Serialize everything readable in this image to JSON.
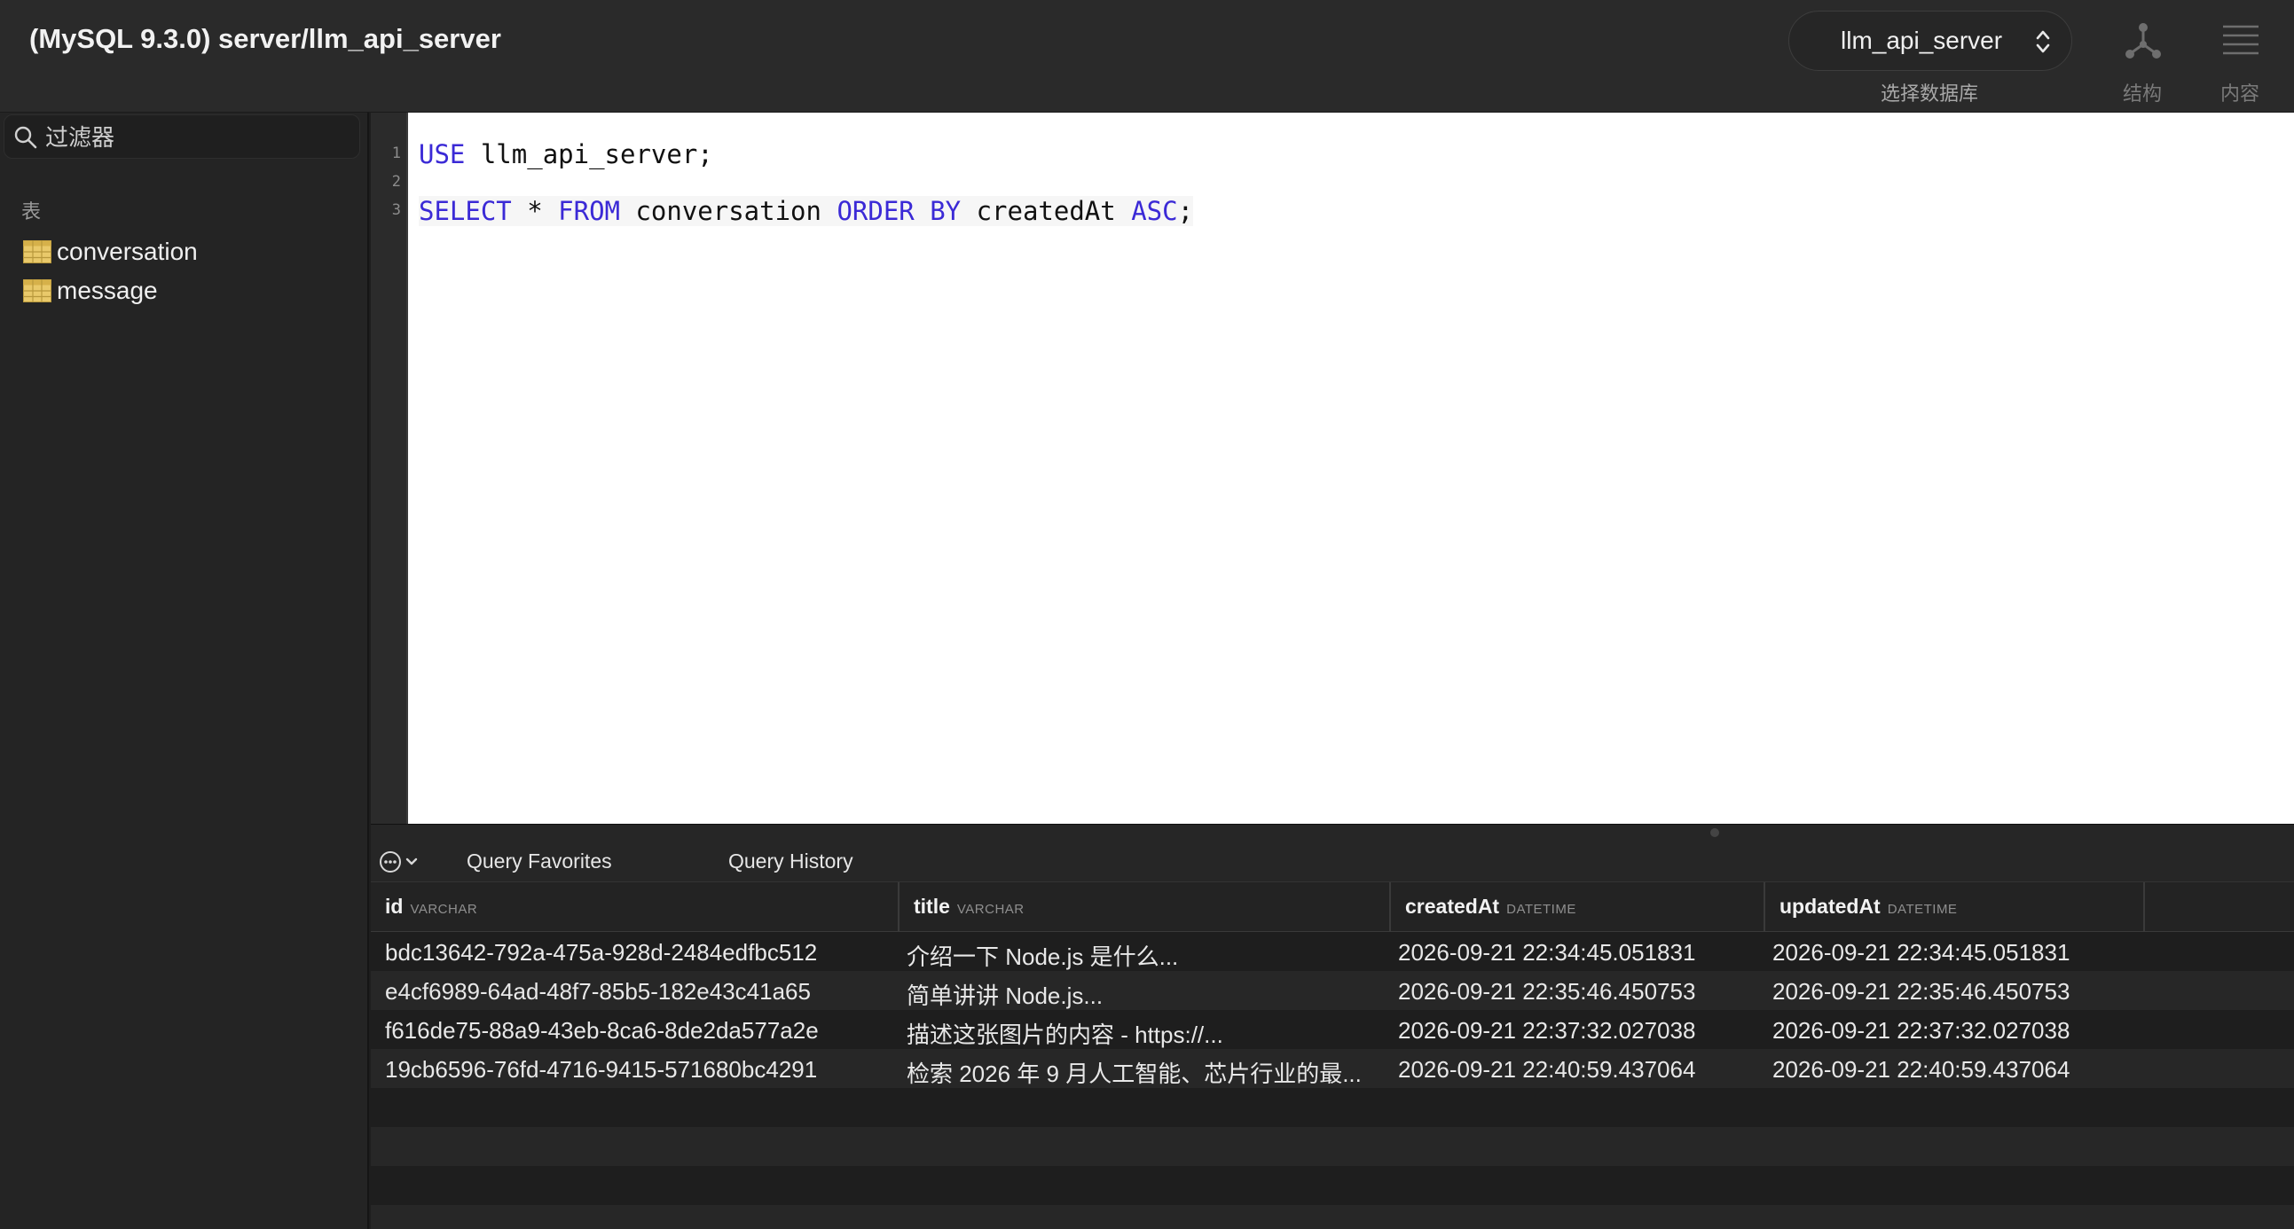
{
  "window": {
    "title": "(MySQL 9.3.0) server/llm_api_server"
  },
  "toolbar": {
    "database_select": {
      "value": "llm_api_server",
      "caption": "选择数据库"
    },
    "buttons": [
      {
        "label": "结构",
        "icon": "structure-icon"
      },
      {
        "label": "内容",
        "icon": "content-icon"
      }
    ]
  },
  "sidebar": {
    "filter": {
      "placeholder": "过滤器",
      "value": ""
    },
    "section_label": "表",
    "tables": [
      {
        "name": "conversation",
        "icon": "table-icon"
      },
      {
        "name": "message",
        "icon": "table-icon"
      }
    ]
  },
  "editor": {
    "line_numbers": [
      "1",
      "2",
      "3"
    ],
    "lines": [
      {
        "tokens": [
          {
            "t": "USE",
            "kw": true
          },
          {
            "t": " llm_api_server;",
            "kw": false
          }
        ]
      },
      {
        "tokens": []
      },
      {
        "tokens": [
          {
            "t": "SELECT",
            "kw": true
          },
          {
            "t": " * ",
            "kw": false
          },
          {
            "t": "FROM",
            "kw": true
          },
          {
            "t": " conversation ",
            "kw": false
          },
          {
            "t": "ORDER BY",
            "kw": true
          },
          {
            "t": " createdAt ",
            "kw": false
          },
          {
            "t": "ASC",
            "kw": true
          },
          {
            "t": ";",
            "kw": false
          }
        ]
      }
    ],
    "colors": {
      "keyword": "#3b2ad6",
      "text": "#111111"
    }
  },
  "results": {
    "tabs": [
      "Query Favorites",
      "Query History"
    ],
    "columns": [
      {
        "name": "id",
        "type": "VARCHAR"
      },
      {
        "name": "title",
        "type": "VARCHAR"
      },
      {
        "name": "createdAt",
        "type": "DATETIME"
      },
      {
        "name": "updatedAt",
        "type": "DATETIME"
      }
    ],
    "rows": [
      [
        "bdc13642-792a-475a-928d-2484edfbc512",
        "介绍一下 Node.js 是什么...",
        "2026-09-21 22:34:45.051831",
        "2026-09-21 22:34:45.051831"
      ],
      [
        "e4cf6989-64ad-48f7-85b5-182e43c41a65",
        "简单讲讲 Node.js...",
        "2026-09-21 22:35:46.450753",
        "2026-09-21 22:35:46.450753"
      ],
      [
        "f616de75-88a9-43eb-8ca6-8de2da577a2e",
        "描述这张图片的内容 - https://...",
        "2026-09-21 22:37:32.027038",
        "2026-09-21 22:37:32.027038"
      ],
      [
        "19cb6596-76fd-4716-9415-571680bc4291",
        "检索 2026 年 9 月人工智能、芯片行业的最...",
        "2026-09-21 22:40:59.437064",
        "2026-09-21 22:40:59.437064"
      ]
    ]
  }
}
